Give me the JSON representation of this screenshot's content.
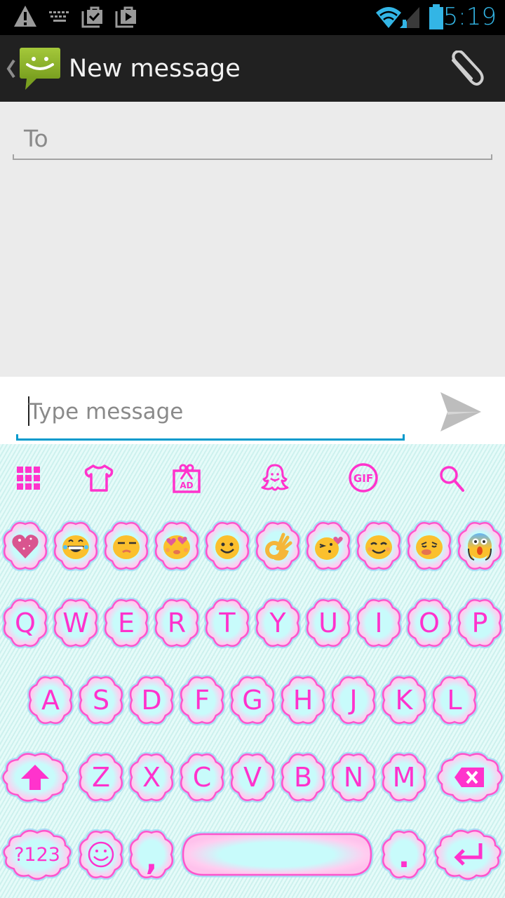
{
  "status_bar": {
    "time": "5:19",
    "left_icons": [
      "warning-icon",
      "keyboard-icon",
      "store-check-icon",
      "store-play-icon"
    ],
    "right_icons": [
      "wifi-icon",
      "signal-icon",
      "battery-icon"
    ],
    "accent_color": "#33b5e5"
  },
  "action_bar": {
    "title": "New message",
    "back_icon": "chevron-left-icon",
    "app_icon": "messaging-app-icon",
    "attach_icon": "paperclip-icon"
  },
  "compose": {
    "to_placeholder": "To",
    "message_placeholder": "Type message",
    "send_icon": "send-icon"
  },
  "keyboard": {
    "theme_colors": {
      "key_text": "#ff33cc",
      "key_center": "#c8fbfb",
      "key_petal": "#ffccee"
    },
    "toolbar": [
      {
        "name": "apps-grid-icon"
      },
      {
        "name": "theme-shirt-icon"
      },
      {
        "name": "ad-gift-icon"
      },
      {
        "name": "ghost-sticker-icon"
      },
      {
        "name": "gif-icon",
        "label": "GIF"
      },
      {
        "name": "search-icon"
      }
    ],
    "emoji_row": [
      {
        "name": "sparkling-heart-emoji"
      },
      {
        "name": "laughing-tears-emoji"
      },
      {
        "name": "unamused-emoji"
      },
      {
        "name": "heart-eyes-emoji"
      },
      {
        "name": "smiley-emoji"
      },
      {
        "name": "ok-hand-emoji"
      },
      {
        "name": "kissing-heart-emoji"
      },
      {
        "name": "blush-emoji"
      },
      {
        "name": "confounded-emoji"
      },
      {
        "name": "scream-emoji"
      }
    ],
    "row1": [
      "Q",
      "W",
      "E",
      "R",
      "T",
      "Y",
      "U",
      "I",
      "O",
      "P"
    ],
    "row2": [
      "A",
      "S",
      "D",
      "F",
      "G",
      "H",
      "J",
      "K",
      "L"
    ],
    "row3": [
      "Z",
      "X",
      "C",
      "V",
      "B",
      "N",
      "M"
    ],
    "row4": {
      "symbols": "?123",
      "comma": ",",
      "period": "."
    }
  }
}
